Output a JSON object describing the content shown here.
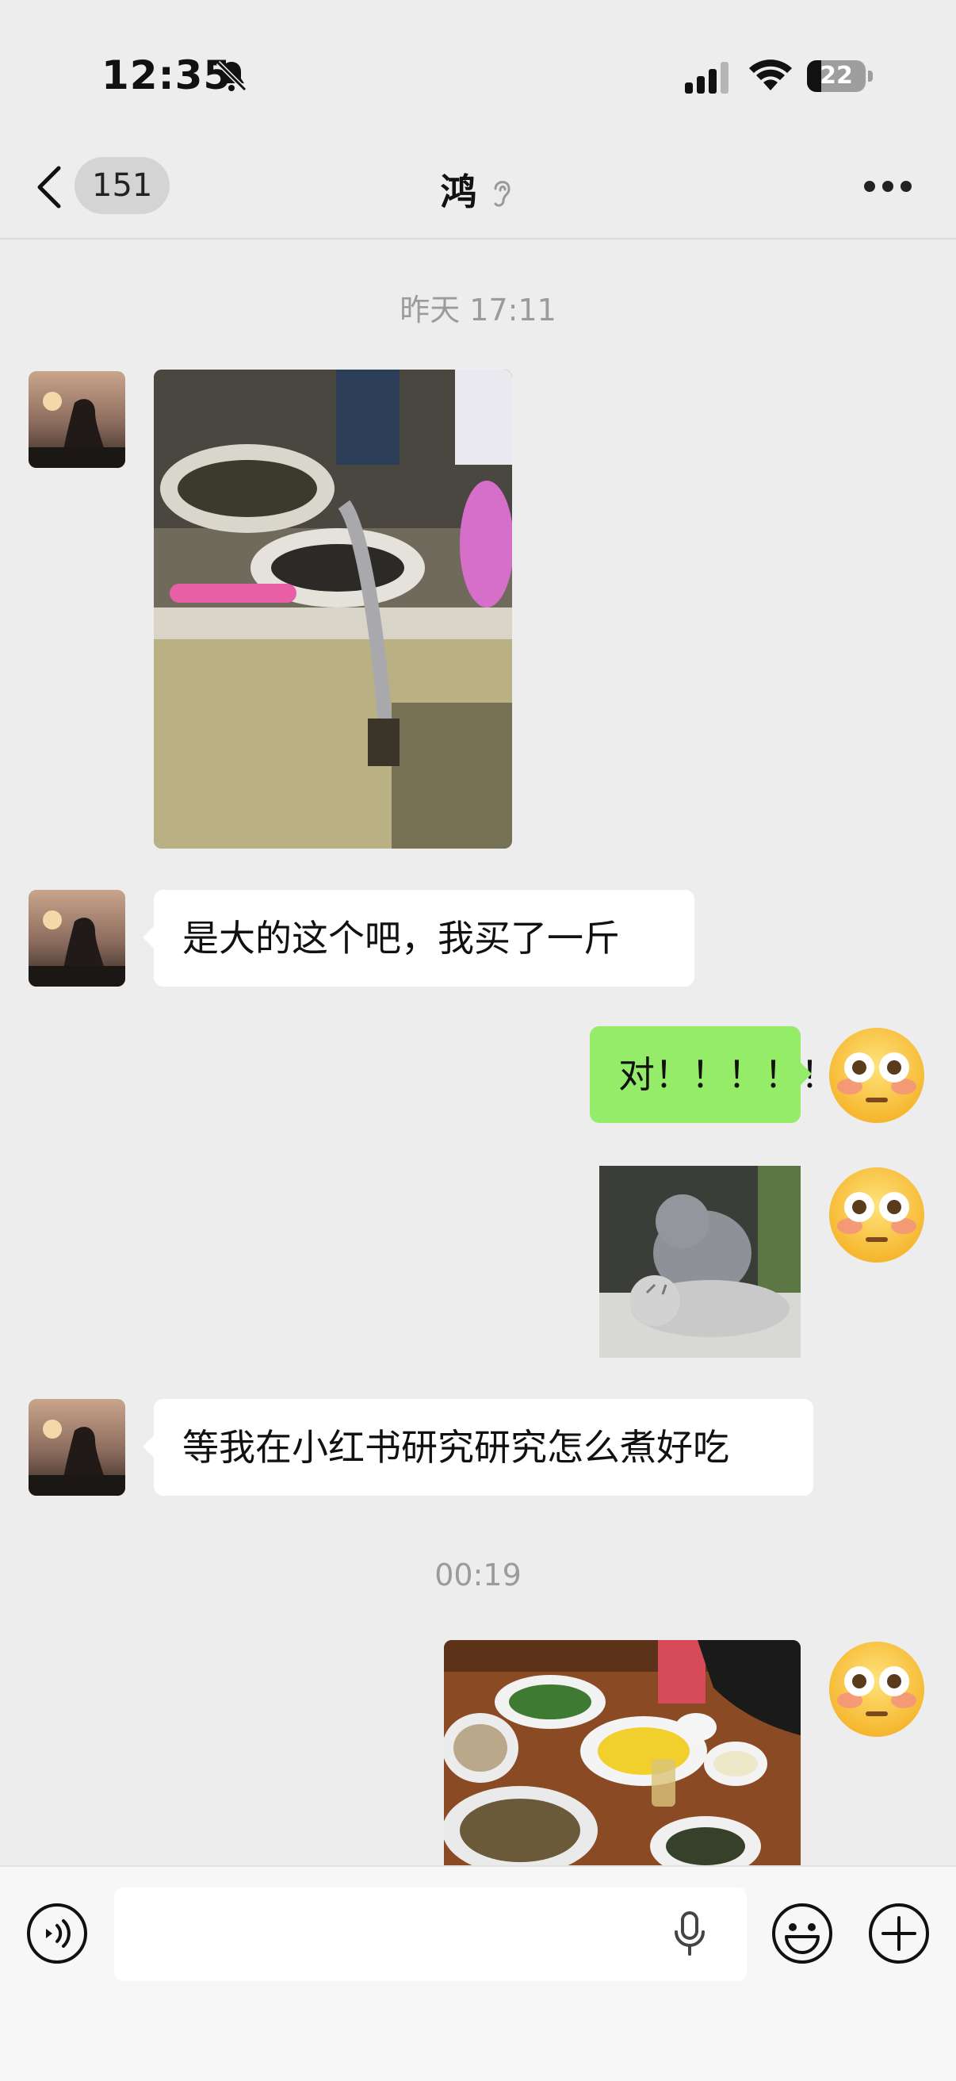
{
  "status_bar": {
    "time": "12:35",
    "battery": "22"
  },
  "nav": {
    "unread_count": "151",
    "contact_name": "鸿"
  },
  "chat": {
    "timestamp_1": "昨天 17:11",
    "msg_in_1": "是大的这个吧，我买了一斤",
    "msg_out_1": "对！！！！！",
    "msg_in_2": "等我在小红书研究研究怎么煮好吃",
    "timestamp_2": "00:19"
  },
  "icons": {
    "back": "chevron-left-icon",
    "mute": "bell-slash-icon",
    "ear": "ear-icon",
    "more": "more-dots-icon",
    "voice": "voice-input-icon",
    "mic": "microphone-icon",
    "emoji": "emoji-icon",
    "plus": "plus-icon"
  },
  "colors": {
    "background": "#ededed",
    "outgoing_bubble": "#95ec69",
    "incoming_bubble": "#ffffff",
    "timestamp": "#9b9b9b"
  }
}
